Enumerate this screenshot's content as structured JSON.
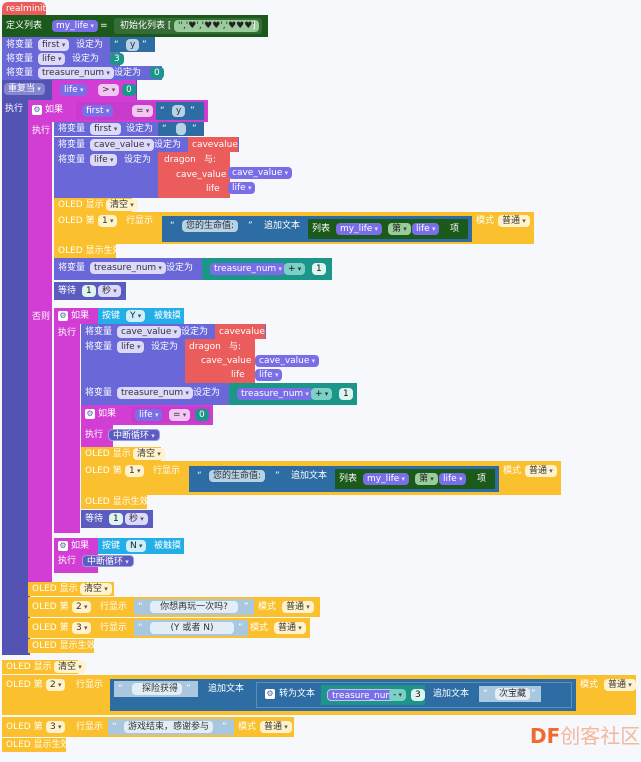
{
  "event_label": "realminit",
  "define_list": {
    "label": "定义列表",
    "var": "my_life",
    "eq": "=",
    "init": "初始化列表 [",
    "items": "'','♥','♥♥','♥♥♥'",
    "close": "]"
  },
  "set_first": {
    "label": "将变量",
    "var": "first",
    "set": "设定为",
    "open_q": "“",
    "value": "y",
    "close_q": "”"
  },
  "set_life": {
    "label": "将变量",
    "var": "life",
    "set": "设定为",
    "value": "3"
  },
  "set_treasure": {
    "label": "将变量",
    "var": "treasure_num",
    "set": "设定为",
    "value": "0"
  },
  "repeat": {
    "mode": "重复当",
    "var": "life",
    "op": ">",
    "value": "0",
    "exec": "执行"
  },
  "if1": {
    "label": "如果",
    "var": "first",
    "op": "=",
    "value": "y",
    "exec": "执行",
    "else": "否则"
  },
  "if1_body": {
    "set_first": {
      "label": "将变量",
      "var": "first",
      "set": "设定为",
      "value": ""
    },
    "set_cave": {
      "label": "将变量",
      "var": "cave_value",
      "set": "设定为",
      "func": "cavevalue"
    },
    "set_life": {
      "label": "将变量",
      "var": "life",
      "set": "设定为",
      "func": "dragon",
      "with": "与:",
      "arg1": "cave_value",
      "arg1_var": "cave_value",
      "arg2": "life",
      "arg2_var": "life"
    },
    "oled_clear": {
      "label": "OLED 显示",
      "mode": "清空"
    },
    "oled_line": {
      "label": "OLED 第",
      "line": "1",
      "show": "行显示",
      "text": "您的生命值:",
      "append": "追加文本",
      "list_label": "列表",
      "list_var": "my_life",
      "index_mode": "第",
      "index_var": "life",
      "item": "项",
      "mode_label": "模式",
      "mode": "普通"
    },
    "oled_show": {
      "label": "OLED 显示生效"
    },
    "set_treasure": {
      "label": "将变量",
      "var": "treasure_num",
      "set": "设定为",
      "expr_var": "treasure_num",
      "op": "+",
      "value": "1"
    },
    "wait": {
      "label": "等待",
      "value": "1",
      "unit": "秒"
    }
  },
  "if2": {
    "label": "如果",
    "button": "按键",
    "key": "Y",
    "event": "被触摸",
    "exec": "执行"
  },
  "if2_body": {
    "set_cave": {
      "label": "将变量",
      "var": "cave_value",
      "set": "设定为",
      "func": "cavevalue"
    },
    "set_life": {
      "label": "将变量",
      "var": "life",
      "set": "设定为",
      "func": "dragon",
      "with": "与:",
      "arg1": "cave_value",
      "arg1_var": "cave_value",
      "arg2": "life",
      "arg2_var": "life"
    },
    "set_treasure": {
      "label": "将变量",
      "var": "treasure_num",
      "set": "设定为",
      "expr_var": "treasure_num",
      "op": "+",
      "value": "1"
    },
    "if3": {
      "label": "如果",
      "var": "life",
      "op": "=",
      "value": "0",
      "exec": "执行",
      "break": "中断循环"
    },
    "oled_clear": {
      "label": "OLED 显示",
      "mode": "清空"
    },
    "oled_line": {
      "label": "OLED 第",
      "line": "1",
      "show": "行显示",
      "text": "您的生命值:",
      "append": "追加文本",
      "list_label": "列表",
      "list_var": "my_life",
      "index_mode": "第",
      "index_var": "life",
      "item": "项",
      "mode_label": "模式",
      "mode": "普通"
    },
    "oled_show": {
      "label": "OLED 显示生效"
    },
    "wait": {
      "label": "等待",
      "value": "1",
      "unit": "秒"
    }
  },
  "if4": {
    "label": "如果",
    "button": "按键",
    "key": "N",
    "event": "被触摸",
    "exec": "执行",
    "break": "中断循环"
  },
  "loop_end": {
    "oled_clear": {
      "label": "OLED 显示",
      "mode": "清空"
    },
    "line2": {
      "label": "OLED 第",
      "line": "2",
      "show": "行显示",
      "text": "你想再玩一次吗?",
      "mode_label": "模式",
      "mode": "普通"
    },
    "line3": {
      "label": "OLED 第",
      "line": "3",
      "show": "行显示",
      "text": "(Y 或者 N)",
      "mode_label": "模式",
      "mode": "普通"
    },
    "oled_show": {
      "label": "OLED 显示生效"
    }
  },
  "final": {
    "oled_clear": {
      "label": "OLED 显示",
      "mode": "清空"
    },
    "line2": {
      "label": "OLED 第",
      "line": "2",
      "show": "行显示",
      "text": "探险获得",
      "append": "追加文本",
      "to_text": "转为文本",
      "expr_var": "treasure_num",
      "op": "-",
      "value": "3",
      "append2": "追加文本",
      "text2": "次宝藏",
      "mode_label": "模式",
      "mode": "普通"
    },
    "line3": {
      "label": "OLED 第",
      "line": "3",
      "show": "行显示",
      "text": "游戏结束，感谢参与",
      "mode_label": "模式",
      "mode": "普通"
    },
    "oled_show": {
      "label": "OLED 显示生效"
    }
  },
  "watermark": {
    "brand": "DF",
    "name": "创客社区"
  }
}
